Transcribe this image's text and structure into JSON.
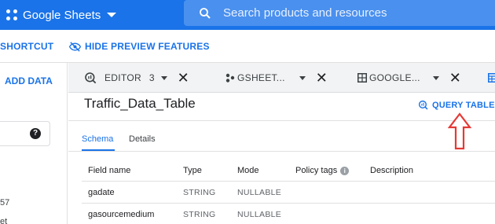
{
  "header": {
    "brand": "Google Sheets",
    "search_placeholder": "Search products and resources"
  },
  "toolbar": {
    "shortcut_label": "SHORTCUT",
    "hide_preview_label": "HIDE PREVIEW FEATURES"
  },
  "left_panel": {
    "add_data_label": "ADD DATA",
    "fragment_1": "57",
    "fragment_2": "et"
  },
  "tabs": [
    {
      "label": "EDITOR",
      "count": "3",
      "icon": "query-icon"
    },
    {
      "label": "GSHEET...",
      "icon": "dots-icon"
    },
    {
      "label": "GOOGLE...",
      "icon": "grid-icon"
    },
    {
      "label": "",
      "icon": "table-icon"
    }
  ],
  "main": {
    "title": "Traffic_Data_Table",
    "query_label": "QUERY TABLE",
    "subtabs": [
      "Schema",
      "Details"
    ]
  },
  "schema": {
    "columns": [
      "Field name",
      "Type",
      "Mode",
      "Policy tags",
      "Description"
    ],
    "rows": [
      [
        "gadate",
        "STRING",
        "NULLABLE",
        "",
        ""
      ],
      [
        "gasourcemedium",
        "STRING",
        "NULLABLE",
        "",
        ""
      ]
    ]
  },
  "colors": {
    "accent": "#1a73e8",
    "annotation_arrow": "#e53935"
  }
}
